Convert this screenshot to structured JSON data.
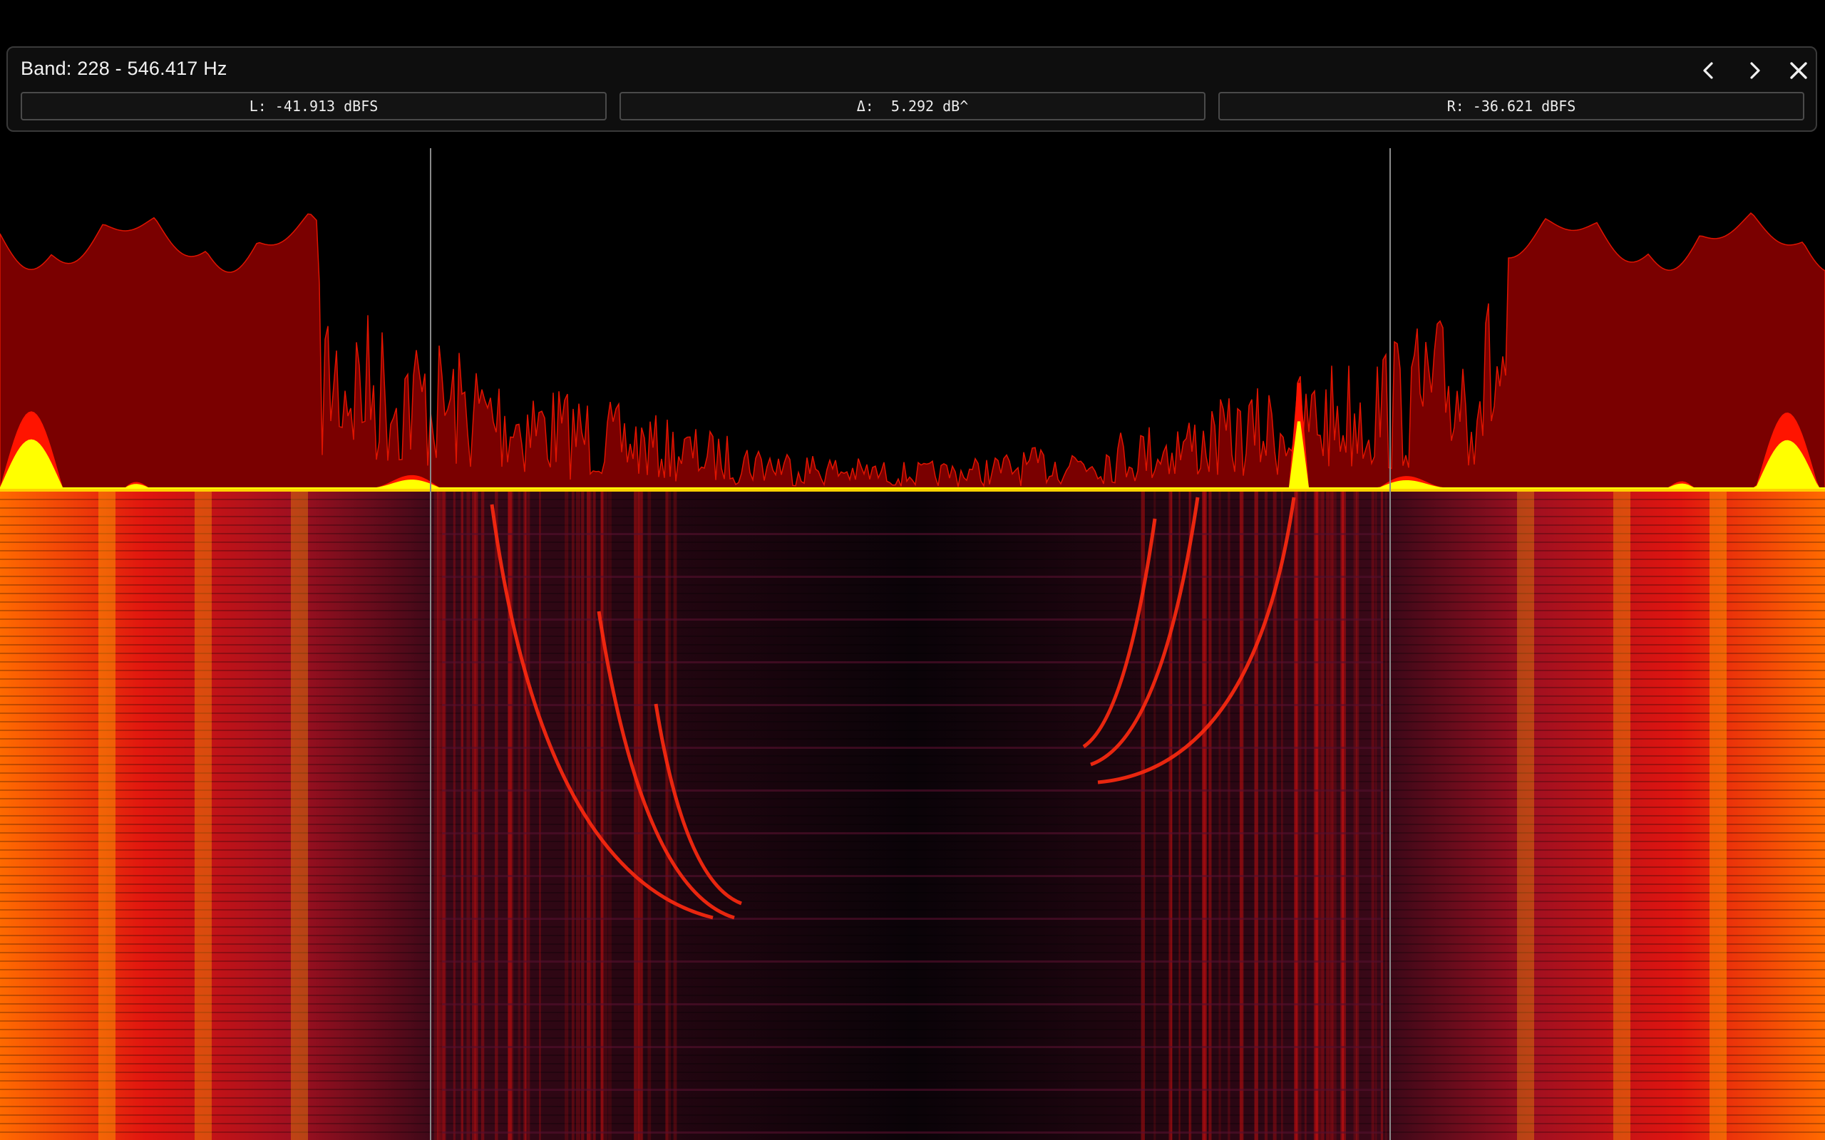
{
  "band_panel": {
    "title": "Band: 228 - 546.417 Hz",
    "left_level": "L: -41.913 dBFS",
    "delta": "Δ:  5.292 dB^",
    "right_level": "R: -36.621 dBFS",
    "prev_icon": "chevron-left-icon",
    "next_icon": "chevron-right-icon",
    "close_icon": "close-icon"
  },
  "colors": {
    "panel_bg": "#0e0e0e",
    "spectrum_fill": "#7a0000",
    "spectrum_peak": "#ff1a00",
    "spectrum_yellow": "#ffff00",
    "marker_line": "#8a8a8a"
  }
}
